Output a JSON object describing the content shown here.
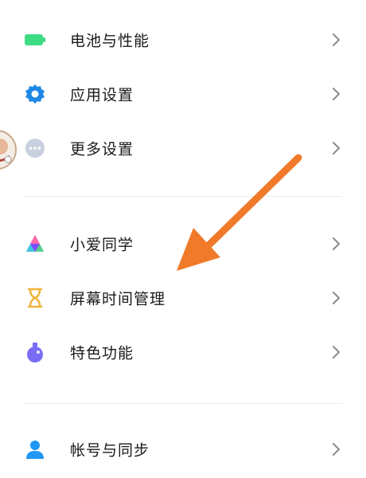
{
  "settings": {
    "items": [
      {
        "label": "电池与性能",
        "icon": "battery-icon",
        "color": "#3ddc84"
      },
      {
        "label": "应用设置",
        "icon": "gear-icon",
        "color": "#1e88e5"
      },
      {
        "label": "更多设置",
        "icon": "more-dots-icon",
        "color": "#c8d0de"
      },
      {
        "label": "小爱同学",
        "icon": "xiaoai-icon",
        "color": "#7c4dff"
      },
      {
        "label": "屏幕时间管理",
        "icon": "hourglass-icon",
        "color": "#f0b43c"
      },
      {
        "label": "特色功能",
        "icon": "flask-icon",
        "color": "#7b6cf6"
      },
      {
        "label": "帐号与同步",
        "icon": "user-icon",
        "color": "#2196f3"
      }
    ]
  },
  "annotation": {
    "type": "arrow",
    "color": "#f07a2a"
  },
  "colors": {
    "text": "#1a1a1a",
    "chevron": "#8a8a8a",
    "divider": "#ececec",
    "background": "#ffffff"
  }
}
